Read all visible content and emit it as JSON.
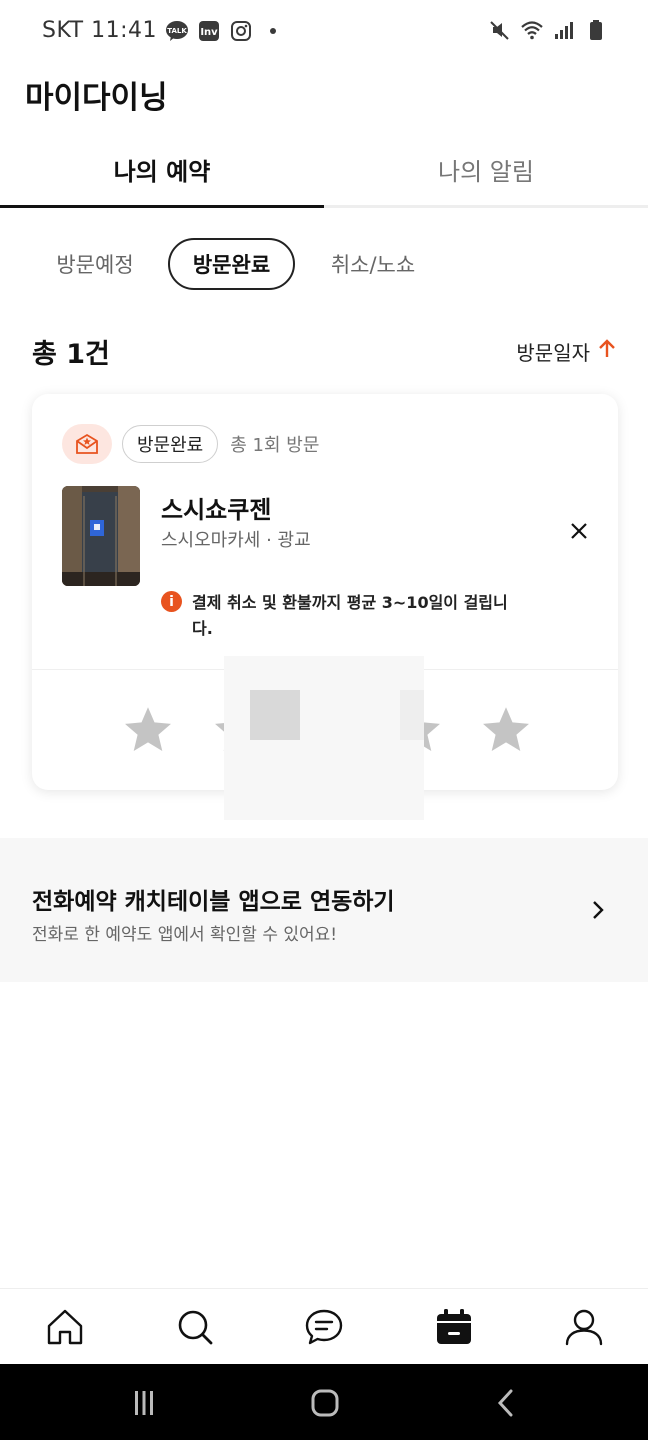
{
  "status_bar": {
    "carrier_time": "SKT 11:41",
    "notif_icons": [
      "talk-icon",
      "inv-icon",
      "instagram-icon",
      "dot-icon"
    ],
    "system_icons": [
      "mute-icon",
      "wifi-icon",
      "signal-icon",
      "battery-icon"
    ],
    "talk_label": "TALK",
    "inv_label": "Inv"
  },
  "header": {
    "title": "마이다이닝"
  },
  "top_tabs": [
    {
      "label": "나의 예약",
      "active": true
    },
    {
      "label": "나의 알림",
      "active": false
    }
  ],
  "filters": [
    {
      "label": "방문예정",
      "selected": false
    },
    {
      "label": "방문완료",
      "selected": true
    },
    {
      "label": "취소/노쇼",
      "selected": false
    }
  ],
  "list_summary": {
    "total": "총 1건",
    "sort_label": "방문일자",
    "sort_direction": "ascending"
  },
  "reservation_card": {
    "badge_icon": "mail-star-icon",
    "status_chip": "방문완료",
    "visit_count": "총 1회 방문",
    "restaurant_name": "스시쇼쿠젠",
    "restaurant_sub": "스시오마카세 · 광교",
    "notice_line1": "결제 취소 및 환불까지 평균 3~10일이 걸립니",
    "notice_line2": "다.",
    "rating": 0,
    "max_rating": 5
  },
  "link_banner": {
    "title": "전화예약 캐치테이블 앱으로 연동하기",
    "subtitle": "전화로 한 예약도 앱에서 확인할 수 있어요!"
  },
  "bottom_nav": [
    {
      "icon": "home-icon",
      "active": false
    },
    {
      "icon": "search-icon",
      "active": false
    },
    {
      "icon": "chat-icon",
      "active": false
    },
    {
      "icon": "calendar-icon",
      "active": true
    },
    {
      "icon": "profile-icon",
      "active": false
    }
  ],
  "colors": {
    "accent": "#e8531f",
    "star": "#c4c4c4",
    "banner_bg": "#f7f7f7"
  }
}
